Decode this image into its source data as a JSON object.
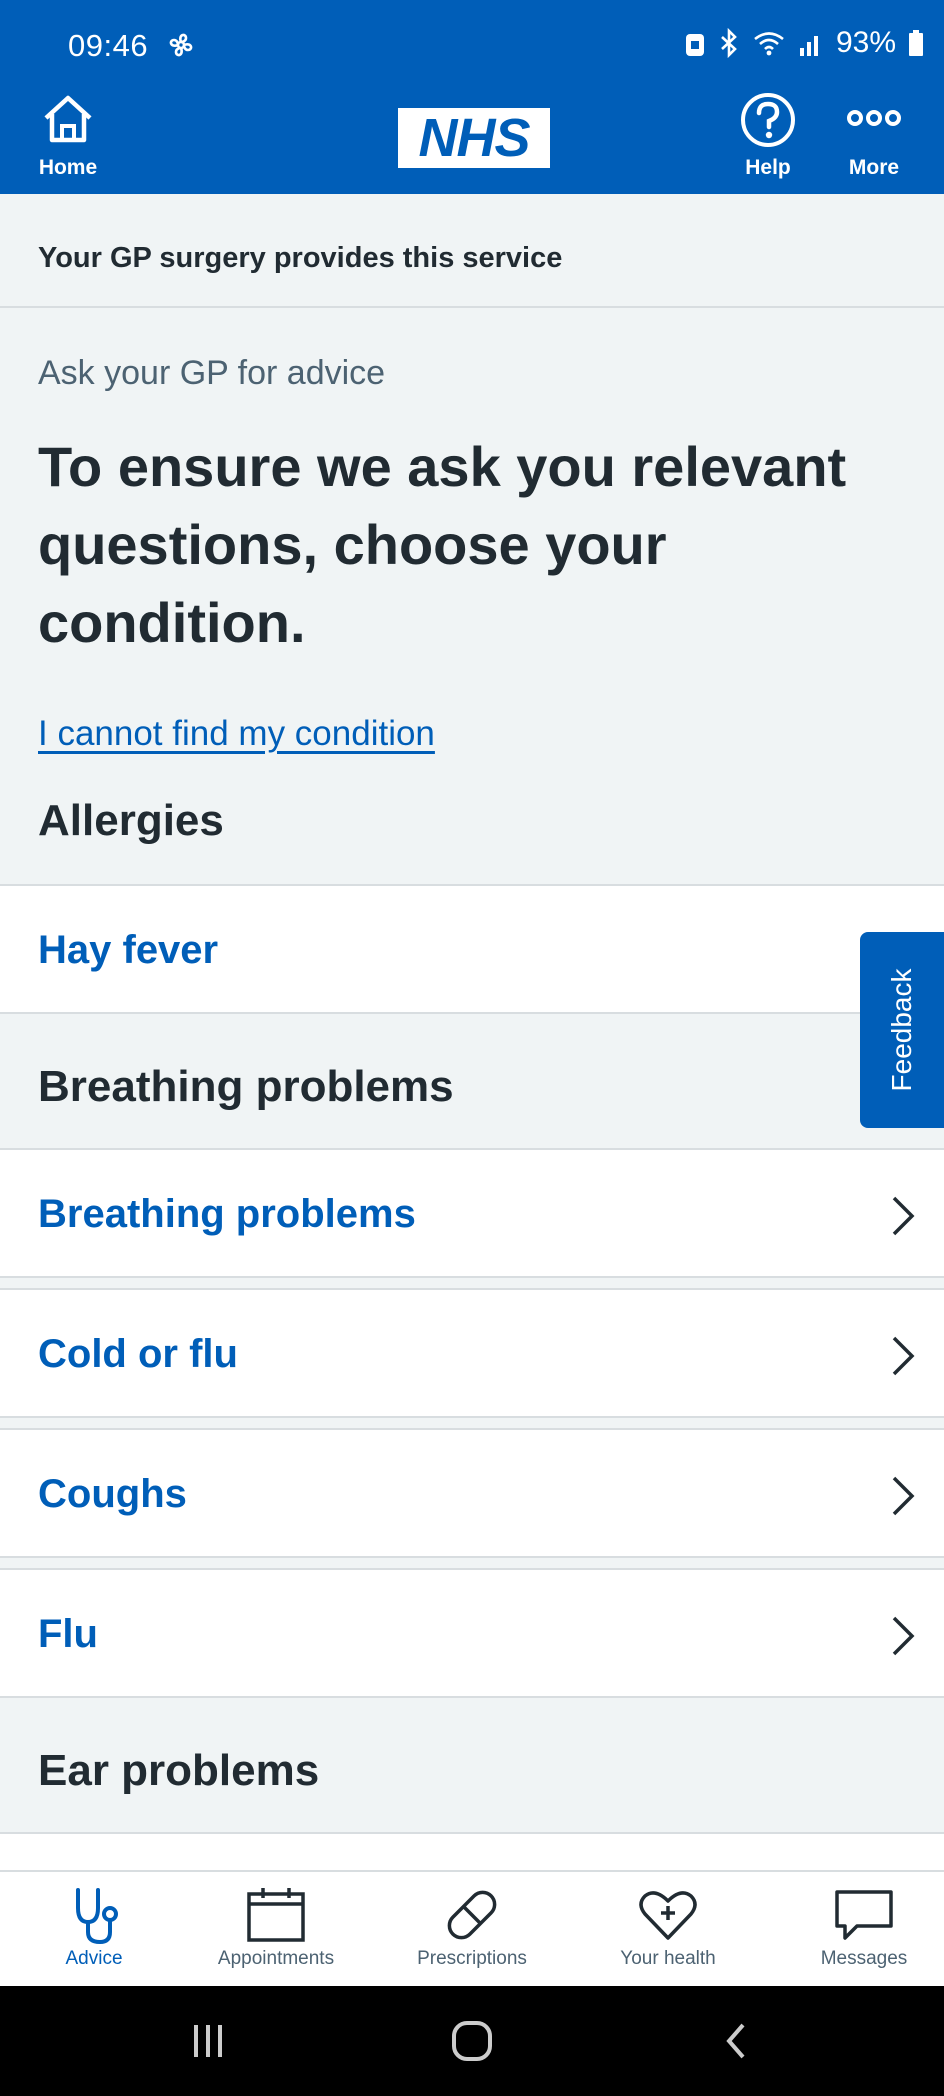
{
  "status_bar": {
    "time": "09:46",
    "battery": "93%"
  },
  "header": {
    "home_label": "Home",
    "logo_text": "NHS",
    "help_label": "Help",
    "more_label": "More"
  },
  "provider_banner": "Your GP surgery provides this service",
  "caption": "Ask your GP for advice",
  "heading": "To ensure we ask you relevant questions, choose your condition.",
  "cannot_find_link": "I cannot find my condition",
  "sections": [
    {
      "title": "Allergies",
      "items": [
        "Hay fever"
      ]
    },
    {
      "title": "Breathing problems",
      "items": [
        "Breathing problems",
        "Cold or flu",
        "Coughs",
        "Flu"
      ]
    },
    {
      "title": "Ear problems",
      "items": []
    }
  ],
  "feedback_label": "Feedback",
  "tabs": [
    {
      "label": "Advice",
      "icon": "stethoscope-icon",
      "active": true
    },
    {
      "label": "Appointments",
      "icon": "calendar-icon",
      "active": false
    },
    {
      "label": "Prescriptions",
      "icon": "pill-icon",
      "active": false
    },
    {
      "label": "Your health",
      "icon": "heart-plus-icon",
      "active": false
    },
    {
      "label": "Messages",
      "icon": "message-icon",
      "active": false
    }
  ],
  "colors": {
    "nhs_blue": "#005eb8",
    "background": "#f0f4f5",
    "text": "#212b32",
    "secondary_text": "#4c6272"
  }
}
